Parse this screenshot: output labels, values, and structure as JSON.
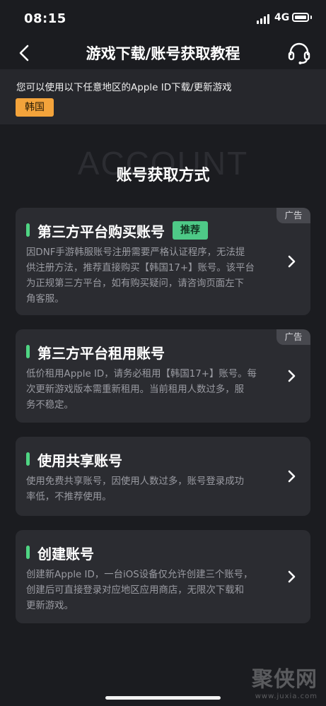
{
  "status": {
    "time": "08:15",
    "network": "4G"
  },
  "nav": {
    "title": "游戏下载/账号获取教程"
  },
  "notice": {
    "text": "您可以使用以下任意地区的Apple ID下载/更新游戏",
    "region": "韩国"
  },
  "section": {
    "watermark": "ACCOUNT",
    "title": "账号获取方式"
  },
  "cards": [
    {
      "title": "第三方平台购买账号",
      "badge": "推荐",
      "ad": "广告",
      "lines": [
        "因DNF手游韩服账号注册需要严格认证程序，无法提",
        "供注册方法，推荐直接购买【韩国17+】账号。该平台",
        "为正规第三方平台，如有购买疑问，请咨询页面左下",
        "角客服。"
      ]
    },
    {
      "title": "第三方平台租用账号",
      "ad": "广告",
      "lines": [
        "低价租用Apple ID，请务必租用【韩国17+】账号。每",
        "次更新游戏版本需重新租用。当前租用人数过多，服",
        "务不稳定。"
      ]
    },
    {
      "title": "使用共享账号",
      "lines": [
        "使用免费共享账号，因使用人数过多，账号登录成功",
        "率低，不推荐使用。"
      ]
    },
    {
      "title": "创建账号",
      "lines": [
        "创建新Apple ID，一台iOS设备仅允许创建三个账号，",
        "创建后可直接登录对应地区应用商店，无限次下载和",
        "更新游戏。"
      ]
    }
  ],
  "watermark": {
    "logo": "聚侠网",
    "url": "www.juxia.com"
  },
  "icons": {
    "back": "chevron-left-icon",
    "support": "headset-icon",
    "chevron": "chevron-right-icon"
  },
  "colors": {
    "accent_green": "#4fd583",
    "badge_green": "#4ec987",
    "region_orange": "#f3a33b"
  }
}
